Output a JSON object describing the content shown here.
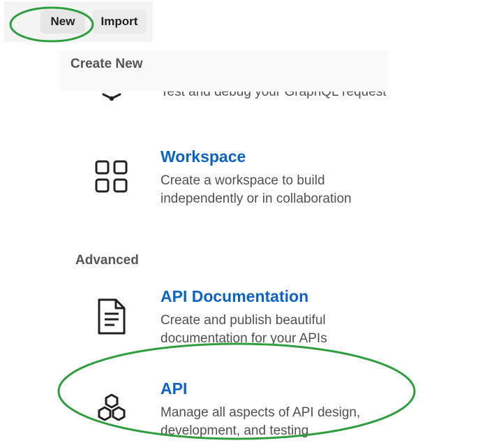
{
  "toolbar": {
    "new_label": "New",
    "import_label": "Import"
  },
  "panel": {
    "header": "Create New",
    "partial_item": {
      "description": "Test and debug your GraphQL request",
      "icon": "graphql-icon"
    },
    "items": [
      {
        "title": "Workspace",
        "description": "Create a workspace to build independently or in collaboration",
        "icon": "workspace-grid-icon"
      }
    ],
    "section_advanced": "Advanced",
    "advanced_items": [
      {
        "title": "API Documentation",
        "description": "Create and publish beautiful documentation for your APIs",
        "icon": "document-icon"
      },
      {
        "title": "API",
        "description": "Manage all aspects of API design, development, and testing",
        "icon": "hexagons-icon"
      }
    ]
  },
  "annotations": {
    "color": "#2e9e3e"
  },
  "colors": {
    "title_blue": "#0b63c7",
    "header_bg": "#f9f9f9"
  }
}
